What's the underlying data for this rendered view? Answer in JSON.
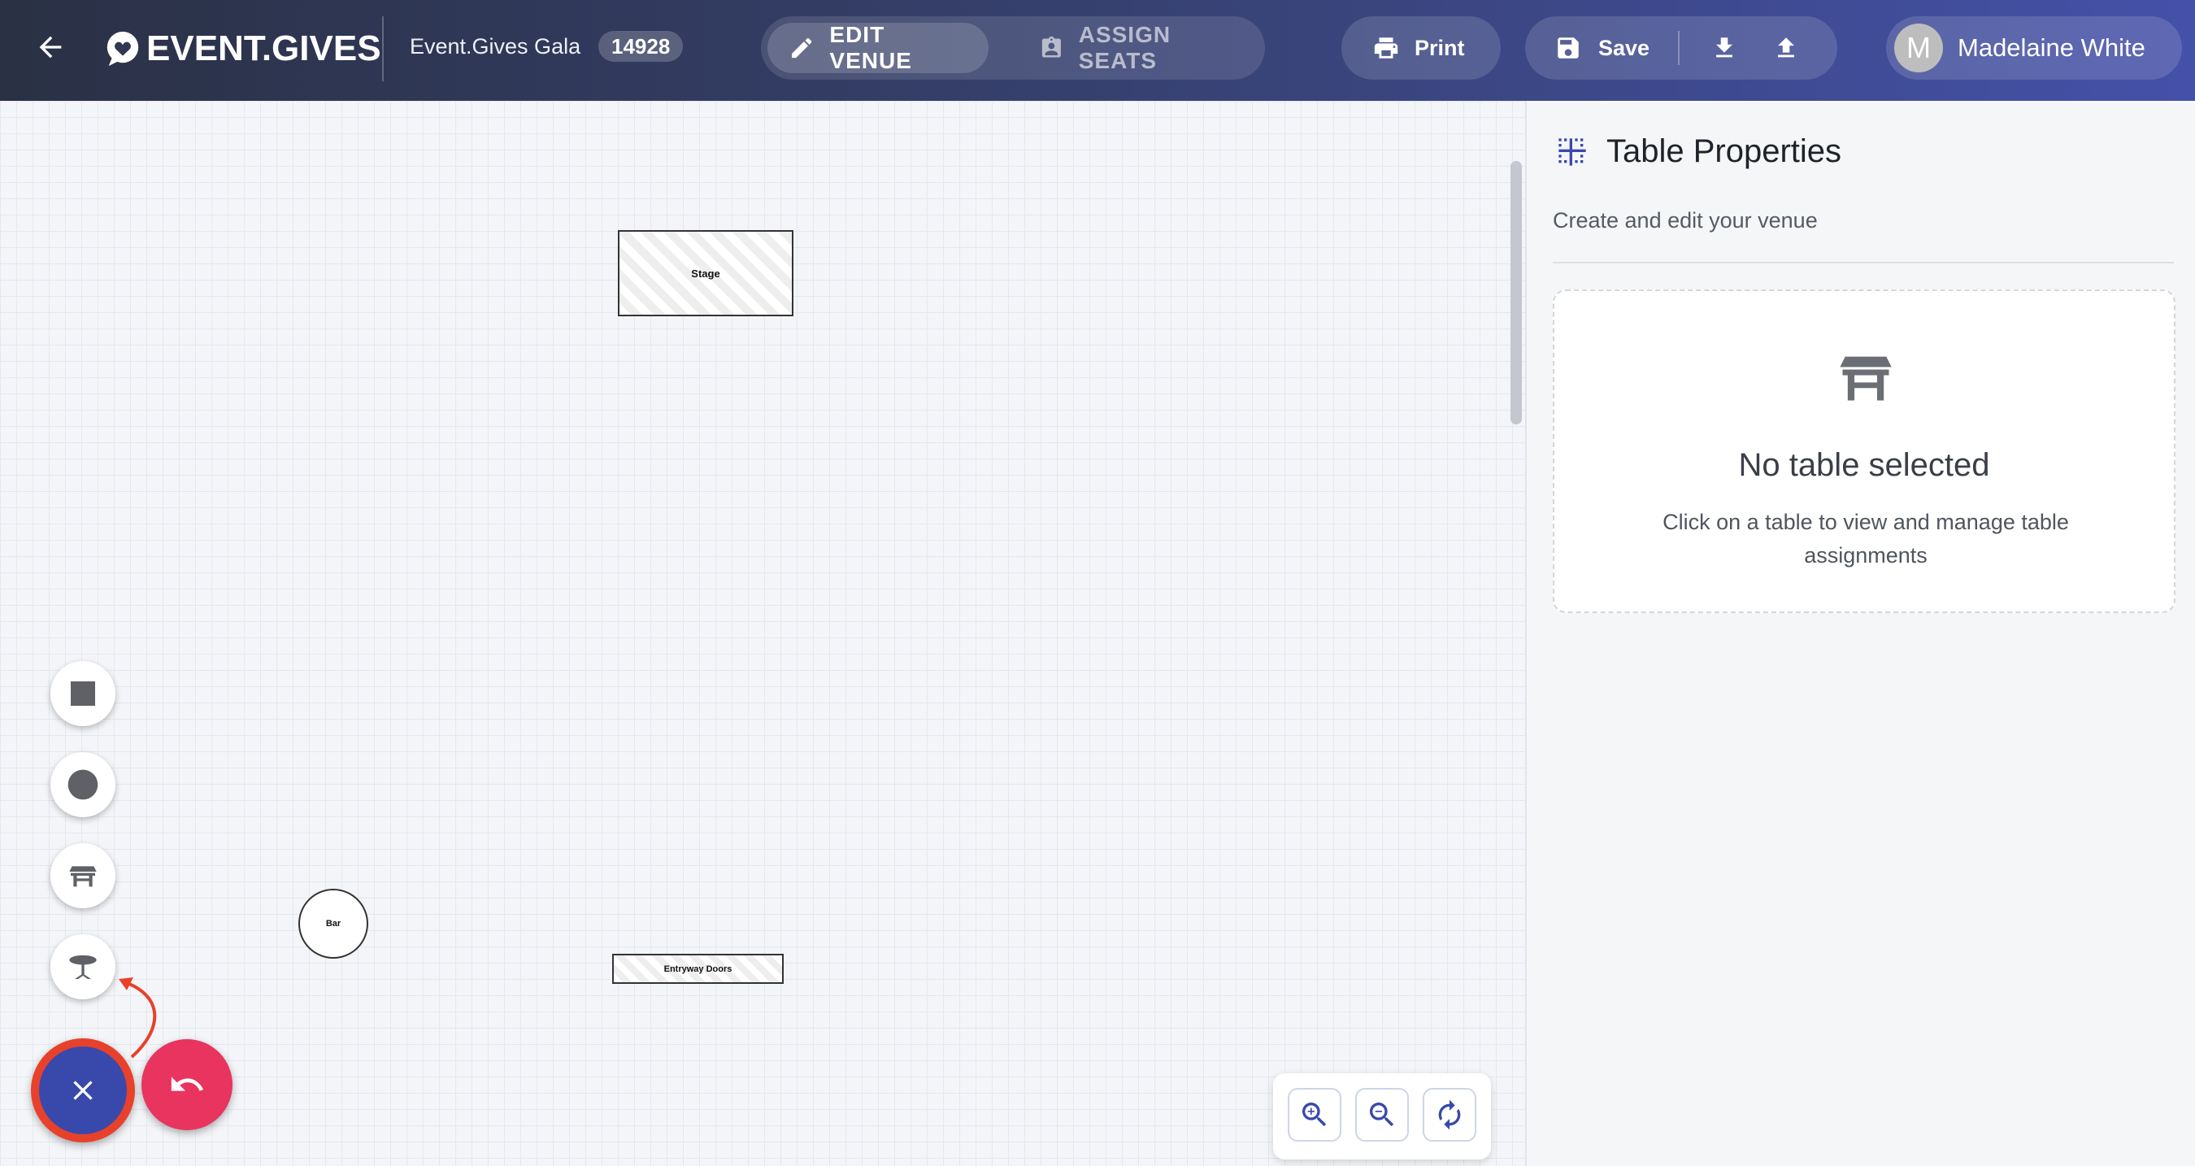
{
  "header": {
    "logo_text": "EVENT.GIVES",
    "event_name": "Event.Gives Gala",
    "event_id": "14928",
    "modes": [
      {
        "label": "EDIT VENUE",
        "active": true
      },
      {
        "label": "ASSIGN SEATS",
        "active": false
      }
    ],
    "print_label": "Print",
    "save_label": "Save",
    "user": {
      "initial": "M",
      "name": "Madelaine White"
    }
  },
  "canvas": {
    "elements": [
      {
        "label": "Stage",
        "shape": "rectangle"
      },
      {
        "label": "Bar",
        "shape": "circle"
      },
      {
        "label": "Entryway Doors",
        "shape": "rectangle"
      }
    ],
    "tools": [
      "square-icon",
      "circle-icon",
      "rect-table-icon",
      "round-table-icon"
    ]
  },
  "panel": {
    "title": "Table Properties",
    "subtitle": "Create and edit your venue",
    "empty_title": "No table selected",
    "empty_description": "Click on a table to view and manage table assignments"
  },
  "colors": {
    "header_start": "#2a3145",
    "header_end": "#4451a8",
    "fab_primary": "#3949ab",
    "fab_undo": "#e8345e",
    "highlight": "#e8412b"
  }
}
